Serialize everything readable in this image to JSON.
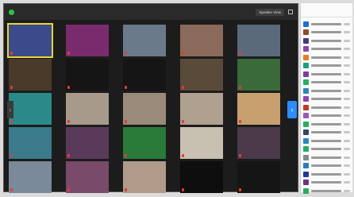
{
  "topbar": {
    "status_text": "",
    "speaker_view_label": "Speaker View"
  },
  "panel": {
    "title": "",
    "participants": [
      {
        "avatar_color": "#1f6fd1"
      },
      {
        "avatar_color": "#8b4c2e"
      },
      {
        "avatar_color": "#4a3a7a"
      },
      {
        "avatar_color": "#8e44ad"
      },
      {
        "avatar_color": "#e67e22"
      },
      {
        "avatar_color": "#16a085"
      },
      {
        "avatar_color": "#7d3c98"
      },
      {
        "avatar_color": "#27ae60"
      },
      {
        "avatar_color": "#2e86c1"
      },
      {
        "avatar_color": "#8e44ad"
      },
      {
        "avatar_color": "#c0392b"
      },
      {
        "avatar_color": "#9b59b6"
      },
      {
        "avatar_color": "#27ae60"
      },
      {
        "avatar_color": "#34495e"
      },
      {
        "avatar_color": "#2e86c1"
      },
      {
        "avatar_color": "#27ae60"
      },
      {
        "avatar_color": "#7f8c8d"
      },
      {
        "avatar_color": "#2980b9"
      },
      {
        "avatar_color": "#1e3799"
      },
      {
        "avatar_color": "#6c3483"
      },
      {
        "avatar_color": "#27ae60"
      }
    ]
  },
  "tiles": [
    {
      "color": "#3b4a8a",
      "active": true
    },
    {
      "color": "#7a2b6d"
    },
    {
      "color": "#6b7a8a"
    },
    {
      "color": "#8a6a5a"
    },
    {
      "color": "#5a6a7a"
    },
    {
      "color": "#4a3a2a"
    },
    {
      "color": "#151515"
    },
    {
      "color": "#151515"
    },
    {
      "color": "#5a4a3a"
    },
    {
      "color": "#3a6a3a"
    },
    {
      "color": "#2a8a8a"
    },
    {
      "color": "#a89a8a"
    },
    {
      "color": "#9a8a7a"
    },
    {
      "color": "#b0a090"
    },
    {
      "color": "#c8a070"
    },
    {
      "color": "#3a7a8a"
    },
    {
      "color": "#5a3a5a"
    },
    {
      "color": "#2a7a3a"
    },
    {
      "color": "#c8c0b0"
    },
    {
      "color": "#4a3a4a"
    },
    {
      "color": "#7a8a9a"
    },
    {
      "color": "#7a4a6a"
    },
    {
      "color": "#b09a8a"
    },
    {
      "color": "#0e0e0e"
    },
    {
      "color": "#151515"
    }
  ]
}
